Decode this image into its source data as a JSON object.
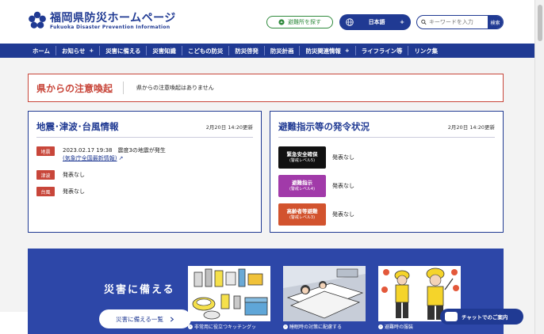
{
  "header": {
    "logo_title": "福岡県防災ホームページ",
    "logo_subtitle": "Fukuoka Disaster Prevention Information",
    "shelter_button": "避難所を探す",
    "language_label": "日本語",
    "language_plus": "+",
    "search_placeholder": "キーワードを入力",
    "search_button": "検索"
  },
  "nav": {
    "items": [
      {
        "label": "ホーム",
        "plus": ""
      },
      {
        "label": "お知らせ",
        "plus": "+"
      },
      {
        "label": "災害に備える",
        "plus": ""
      },
      {
        "label": "災害知識",
        "plus": ""
      },
      {
        "label": "こどもの防災",
        "plus": ""
      },
      {
        "label": "防災啓発",
        "plus": ""
      },
      {
        "label": "防災計画",
        "plus": ""
      },
      {
        "label": "防災関連情報",
        "plus": "+"
      },
      {
        "label": "ライフライン等",
        "plus": ""
      },
      {
        "label": "リンク集",
        "plus": ""
      }
    ]
  },
  "caution": {
    "title": "県からの注意喚起",
    "message": "県からの注意喚起はありません"
  },
  "quake_panel": {
    "title": "地震･津波･台風情報",
    "time": "2月20日 14:20更新",
    "rows": [
      {
        "badge": "地震",
        "line1": "2023.02.17 19:38　震度3の地震が発生",
        "link": "(気象庁全国最新情報)"
      },
      {
        "badge": "津波",
        "line1": "発表なし"
      },
      {
        "badge": "台風",
        "line1": "発表なし"
      }
    ],
    "ext_icon": "↗"
  },
  "evac_panel": {
    "title": "避難指示等の発令状況",
    "time": "2月20日 14:20更新",
    "rows": [
      {
        "name": "緊急安全確保",
        "level": "(警戒レベル5)",
        "status": "発表なし",
        "color": "#111111"
      },
      {
        "name": "避難指示",
        "level": "(警戒レベル4)",
        "status": "発表なし",
        "color": "#a13aa9"
      },
      {
        "name": "高齢者等避難",
        "level": "(警戒レベル3)",
        "status": "発表なし",
        "color": "#d2532e"
      }
    ]
  },
  "prep": {
    "title": "災害に備える",
    "button": "災害に備える一覧",
    "cards": [
      {
        "caption": "非常用に役立つキッチングッ"
      },
      {
        "caption": "睡眠時の対策に配慮する"
      },
      {
        "caption": "避難時の服装"
      }
    ]
  },
  "chat": {
    "label": "チャットでのご案内"
  },
  "colors": {
    "brand": "#203a93",
    "alert": "#c8463a",
    "green": "#2f8a3c"
  }
}
